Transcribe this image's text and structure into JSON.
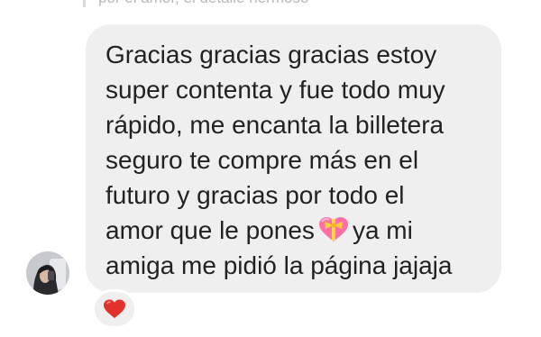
{
  "quoted": {
    "text": "por el amor, el detalle hermoso"
  },
  "message": {
    "lines": [
      "Gracias gracias gracias estoy",
      "super contenta y fue todo muy",
      "rápido, me encanta la billetera",
      "seguro te compre más en el",
      "futuro y gracias por todo el",
      "amor que le pones",
      "ya mi",
      "amiga me pidió la página jajaja"
    ],
    "inline_emoji": "gift-heart-icon"
  },
  "reaction": {
    "emoji": "red-heart-icon"
  },
  "colors": {
    "bubble": "#efefef",
    "text": "#222222",
    "reaction_heart": "#e2312d",
    "gift_heart": "#ff6fa6",
    "ribbon": "#ffd54a"
  }
}
